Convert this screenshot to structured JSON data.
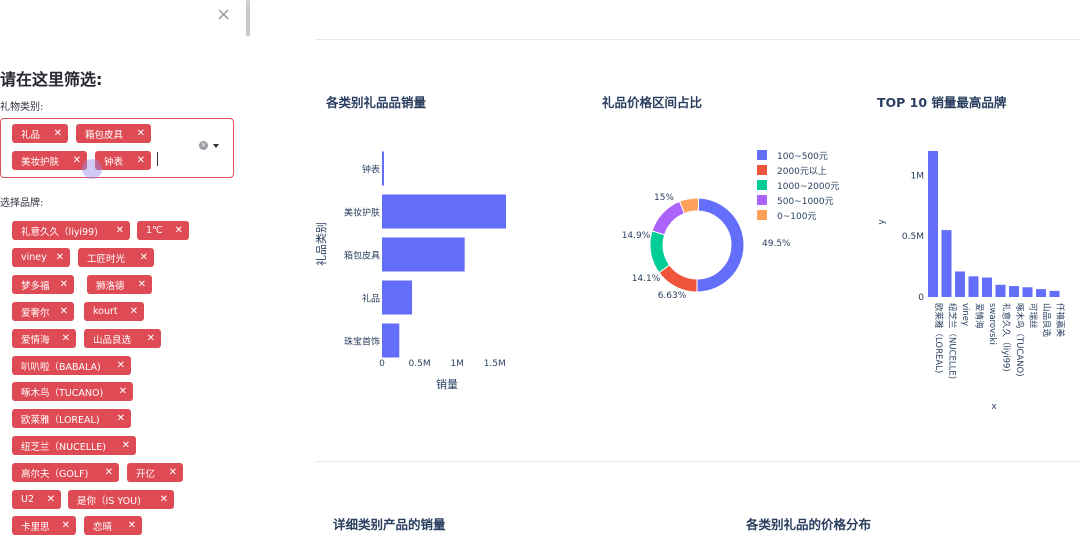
{
  "sidebar": {
    "close_icon": "×",
    "title": "请在这里筛选:",
    "category_label": "礼物类别:",
    "category_tags": [
      "礼品",
      "箱包皮具",
      "美妆护肤",
      "钟表"
    ],
    "brand_label": "选择品牌:",
    "brand_tags": [
      "礼意久久（liyi99)",
      "1℃",
      "viney",
      "工匠时光",
      "梦多福",
      "狮洛德",
      "爱奢尔",
      "kourt",
      "爱情海",
      "山品良选",
      "叭叭啦（BABALA)",
      "啄木鸟（TUCANO)",
      "欧莱雅（LOREAL)",
      "纽芝兰（NUCELLE)",
      "高尔夫（GOLF)",
      "开亿",
      "U2",
      "是你（IS YOU)",
      "卡里思",
      "恋晴"
    ]
  },
  "charts": {
    "bar_title": "各类别礼品品销量",
    "pie_title": "礼品价格区间占比",
    "top10_title": "TOP 10 销量最高品牌",
    "detail_title": "详细类别产品的销量",
    "dist_title": "各类别礼品的价格分布"
  },
  "chart_data": [
    {
      "type": "bar",
      "orientation": "horizontal",
      "categories": [
        "钟表",
        "美妆护肤",
        "箱包皮具",
        "礼品",
        "珠宝首饰"
      ],
      "values": [
        20000,
        1650000,
        1100000,
        400000,
        230000
      ],
      "xlabel": "销量",
      "ylabel": "礼品类别",
      "xticks": [
        "0",
        "0.5M",
        "1M",
        "1.5M"
      ],
      "xlim": [
        0,
        1650000
      ],
      "color": "#636efa"
    },
    {
      "type": "pie",
      "hole": true,
      "labels": [
        "100~500元",
        "2000元以上",
        "1000~2000元",
        "500~1000元",
        "0~100元"
      ],
      "values": [
        49.5,
        15,
        14.9,
        14.1,
        6.63
      ],
      "value_labels": [
        "49.5%",
        "15%",
        "14.9%",
        "14.1%",
        "6.63%"
      ],
      "colors": [
        "#636efa",
        "#ef553b",
        "#00cc96",
        "#ab63fa",
        "#ffa15a"
      ]
    },
    {
      "type": "bar",
      "categories": [
        "欧莱雅（LOREAL)",
        "纽芝兰（NUCELLE)",
        "viney",
        "爱情海",
        "swarovski",
        "礼意久久（liyi99)",
        "啄木鸟（TUCANO)",
        "可瑞丝",
        "山品良选",
        "仟禧嘉美"
      ],
      "values": [
        1200000,
        550000,
        210000,
        170000,
        160000,
        100000,
        90000,
        80000,
        65000,
        50000
      ],
      "xlabel": "x",
      "ylabel": "y",
      "yticks": [
        "0",
        "0.5M",
        "1M"
      ],
      "ylim": [
        0,
        1200000
      ],
      "color": "#636efa"
    }
  ]
}
